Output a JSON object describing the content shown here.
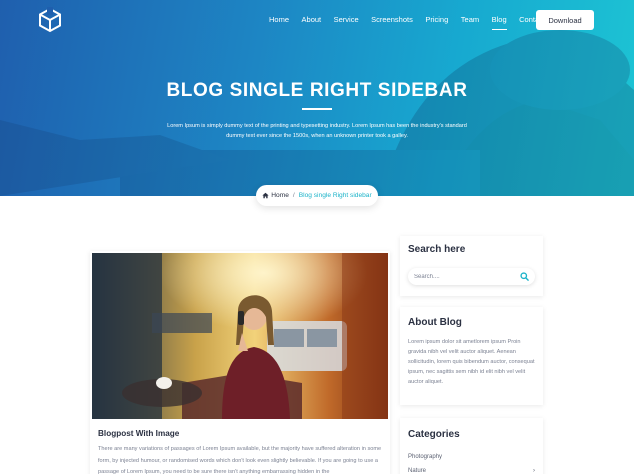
{
  "nav": {
    "items": [
      "Home",
      "About",
      "Service",
      "Screenshots",
      "Pricing",
      "Team",
      "Blog",
      "Contact"
    ],
    "active": "Blog",
    "download_label": "Download"
  },
  "hero": {
    "title": "BLOG SINGLE RIGHT SIDEBAR",
    "subtitle": "Lorem Ipsum is simply dummy text of the printing and typesetting industry. Lorem Ipsum has been the industry's standard dummy text ever since the 1500s, when an unknown printer took a galley."
  },
  "breadcrumb": {
    "home": "Home",
    "separator": "/",
    "current": "Blog single Right sidebar"
  },
  "post": {
    "title": "Blogpost With Image",
    "text": "There are many variations of passages of Lorem Ipsum available, but the majority have suffered alteration in some form, by injected humour, or randomised words which don't look even slightly believable. If you are going to use a passage of Lorem Ipsum, you need to be sure there isn't anything embarrassing hidden in the"
  },
  "sidebar": {
    "search": {
      "title": "Search here",
      "placeholder": "Search...."
    },
    "about": {
      "title": "About Blog",
      "text": "Lorem ipsum dolor sit ametlorem ipsum Proin gravida nibh vel velit auctor aliquet. Aenean sollicitudin, lorem quis bibendum auctor, consequat ipsum, nec sagittis sem nibh id elit nibh vel velit auctor aliquet."
    },
    "categories": {
      "title": "Categories",
      "items": [
        "Photography",
        "Nature"
      ]
    }
  },
  "colors": {
    "accent": "#1bb3c9",
    "hero_start": "#1f5fae",
    "hero_end": "#1dc5d4",
    "heading": "#2b3142",
    "body_text": "#7c8293"
  }
}
